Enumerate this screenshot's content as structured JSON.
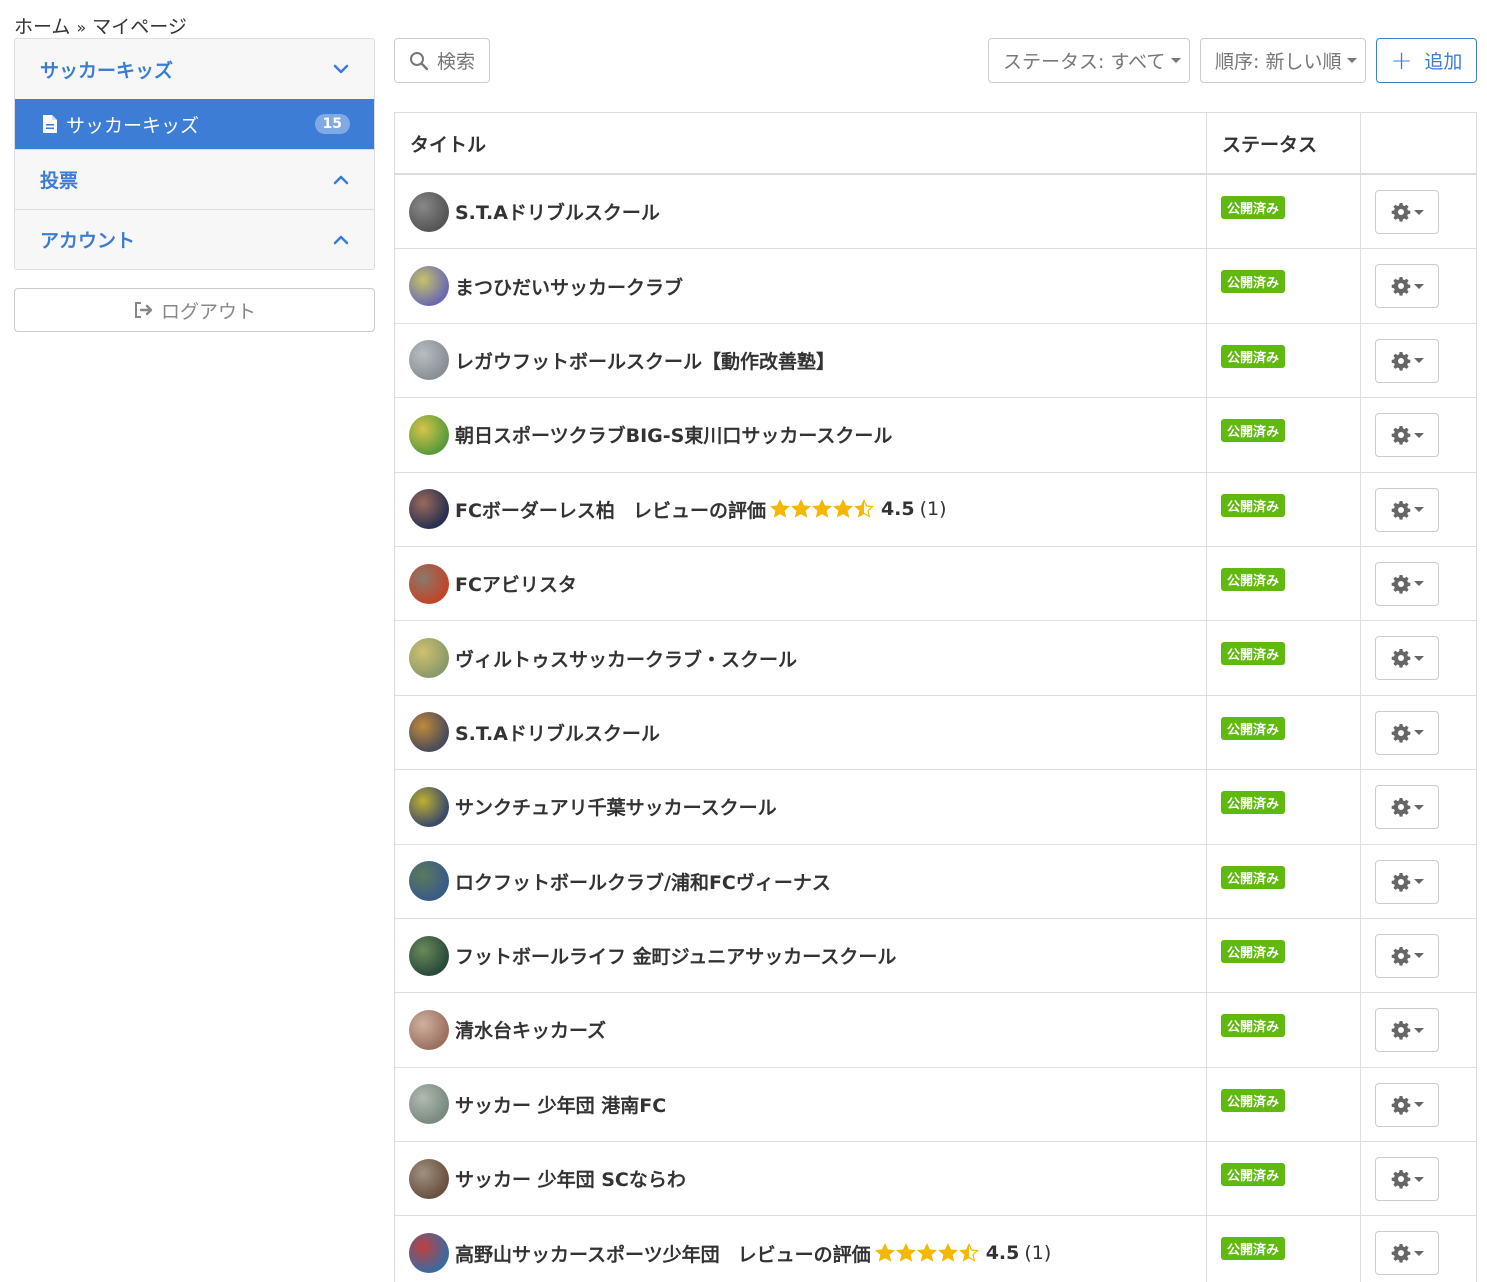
{
  "breadcrumb": {
    "home": "ホーム",
    "separator": "»",
    "current": "マイページ"
  },
  "sidebar": {
    "sections": [
      {
        "title": "サッカーキッズ",
        "chevron": "chevron-down-icon"
      },
      {
        "title": "投票",
        "chevron": "chevron-up-icon"
      },
      {
        "title": "アカウント",
        "chevron": "chevron-up-icon"
      }
    ],
    "active_item": {
      "label": "サッカーキッズ",
      "count": "15",
      "icon": "document-icon"
    },
    "logout_label": "ログアウト"
  },
  "toolbar": {
    "search_label": "検索",
    "status_filter": "ステータス: すべて",
    "order_filter": "順序: 新しい順",
    "add_label": "追加"
  },
  "table": {
    "headers": {
      "title": "タイトル",
      "status": "ステータス"
    },
    "rows": [
      {
        "title": "S.T.Aドリブルスクール",
        "status": "公開済み"
      },
      {
        "title": "まつひだいサッカークラブ",
        "status": "公開済み"
      },
      {
        "title": "レガウフットボールスクール【動作改善塾】",
        "status": "公開済み"
      },
      {
        "title": "朝日スポーツクラブBIG-S東川口サッカースクール",
        "status": "公開済み"
      },
      {
        "title": "FCボーダーレス柏",
        "status": "公開済み",
        "review_label": "レビューの評価",
        "rating": 4.5,
        "score": "4.5",
        "count": "(1)"
      },
      {
        "title": "FCアビリスタ",
        "status": "公開済み"
      },
      {
        "title": "ヴィルトゥスサッカークラブ・スクール",
        "status": "公開済み"
      },
      {
        "title": "S.T.Aドリブルスクール",
        "status": "公開済み"
      },
      {
        "title": "サンクチュアリ千葉サッカースクール",
        "status": "公開済み"
      },
      {
        "title": "ロクフットボールクラブ/浦和FCヴィーナス",
        "status": "公開済み"
      },
      {
        "title": "フットボールライフ 金町ジュニアサッカースクール",
        "status": "公開済み"
      },
      {
        "title": "清水台キッカーズ",
        "status": "公開済み"
      },
      {
        "title": "サッカー 少年団 港南FC",
        "status": "公開済み"
      },
      {
        "title": "サッカー 少年団 SCならわ",
        "status": "公開済み"
      },
      {
        "title": "高野山サッカースポーツ少年団",
        "status": "公開済み",
        "review_label": "レビューの評価",
        "rating": 4.5,
        "score": "4.5",
        "count": "(1)"
      }
    ]
  },
  "colors": {
    "accent": "#3e7dd6",
    "section_title": "#3c7dd4",
    "status_green": "#5fb90f",
    "star": "#f5b800"
  }
}
